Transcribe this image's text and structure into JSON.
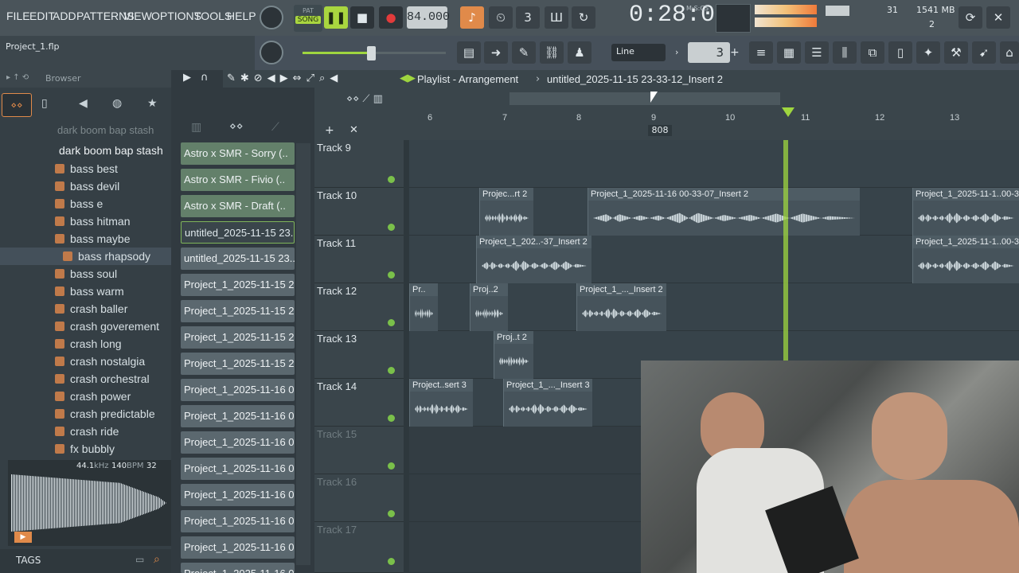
{
  "menu": [
    "FILE",
    "EDIT",
    "ADD",
    "PATTERNS",
    "VIEW",
    "OPTIONS",
    "TOOLS",
    "HELP"
  ],
  "transport": {
    "mode_pat": "PAT",
    "mode_song": "SONG",
    "tempo": "84.000",
    "time": "0:28:07",
    "time_label": "M:S:CS"
  },
  "meters": {
    "cpu_value": "31",
    "memory": "1541 MB",
    "voices": "2"
  },
  "project_file": "Project_1.flp",
  "snap": {
    "value": "Line",
    "step": "3"
  },
  "browser": {
    "title": "Browser",
    "breadcrumb": "dark boom bap stash",
    "folder": "dark boom bap stash",
    "items": [
      "bass best",
      "bass devil",
      "bass e",
      "bass hitman",
      "bass maybe",
      "bass rhapsody",
      "bass soul",
      "bass warm",
      "crash baller",
      "crash goverement",
      "crash long",
      "crash nostalgia",
      "crash orchestral",
      "crash power",
      "crash predictable",
      "crash ride",
      "fx bubbly"
    ],
    "selected": "bass rhapsody",
    "sample_info": {
      "rate": "44.1",
      "rate_unit": "kHz",
      "bpm": "140",
      "bpm_unit": "BPM",
      "bits": "32"
    },
    "tags_label": "TAGS"
  },
  "patterns": [
    "Astro x SMR - Sorry (..",
    "Astro x SMR - Fivio (..",
    "Astro x SMR - Draft (..",
    "untitled_2025-11-15 23...",
    "untitled_2025-11-15 23...",
    "Project_1_2025-11-15 2...",
    "Project_1_2025-11-15 2...",
    "Project_1_2025-11-15 2...",
    "Project_1_2025-11-15 2...",
    "Project_1_2025-11-16 0...",
    "Project_1_2025-11-16 0...",
    "Project_1_2025-11-16 0...",
    "Project_1_2025-11-16 0...",
    "Project_1_2025-11-16 0...",
    "Project_1_2025-11-16 0...",
    "Project_1_2025-11-16 0...",
    "Project_1_2025-11-16 0..."
  ],
  "playlist": {
    "title": "Playlist - Arrangement",
    "pattern": "untitled_2025-11-15 23-33-12_Insert 2",
    "marker": "808",
    "ruler": [
      "6",
      "7",
      "8",
      "9",
      "10",
      "11",
      "12",
      "13"
    ],
    "tracks": [
      "Track 9",
      "Track 10",
      "Track 11",
      "Track 12",
      "Track 13",
      "Track 14",
      "Track 15",
      "Track 16",
      "Track 17"
    ],
    "clips": [
      {
        "label": "Projec...rt 2"
      },
      {
        "label": "Project_1_2025-11-16 00-33-07_Insert 2"
      },
      {
        "label": "Project_1_2025-11-1..00-3"
      },
      {
        "label": "Project_1_202..-37_Insert 2"
      },
      {
        "label": "Project_1_2025-11-1..00-3"
      },
      {
        "label": "Pr.."
      },
      {
        "label": "Proj..2"
      },
      {
        "label": "Project_1_..._Insert 2"
      },
      {
        "label": "Proj..t 2"
      },
      {
        "label": "Project..sert 3"
      },
      {
        "label": "Project_1_..._Insert 3"
      }
    ]
  }
}
